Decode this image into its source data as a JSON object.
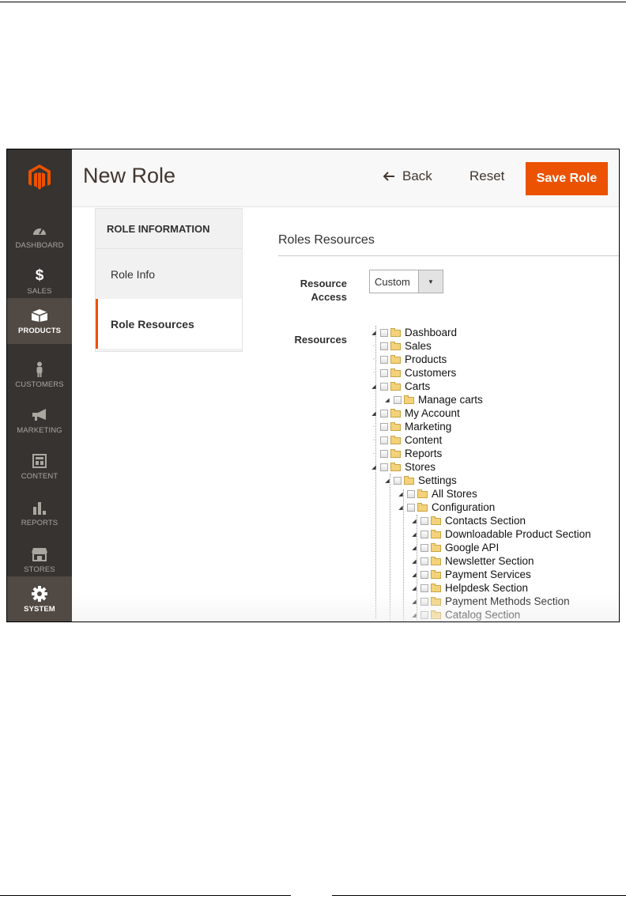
{
  "header": {
    "title": "New Role",
    "back_label": "Back",
    "reset_label": "Reset",
    "save_label": "Save Role"
  },
  "sidebar": {
    "items": [
      {
        "label": "DASHBOARD",
        "icon": "dashboard-icon"
      },
      {
        "label": "SALES",
        "icon": "dollar-icon"
      },
      {
        "label": "PRODUCTS",
        "icon": "box-icon"
      },
      {
        "label": "CUSTOMERS",
        "icon": "person-icon"
      },
      {
        "label": "MARKETING",
        "icon": "megaphone-icon"
      },
      {
        "label": "CONTENT",
        "icon": "layout-icon"
      },
      {
        "label": "REPORTS",
        "icon": "bar-chart-icon"
      },
      {
        "label": "STORES",
        "icon": "storefront-icon"
      },
      {
        "label": "SYSTEM",
        "icon": "gear-icon"
      }
    ]
  },
  "tabs": {
    "title": "ROLE INFORMATION",
    "items": [
      {
        "label": "Role Info"
      },
      {
        "label": "Role Resources"
      }
    ]
  },
  "main": {
    "section_title": "Roles Resources",
    "resource_access_label": "Resource Access",
    "resource_access_value": "Custom",
    "resources_label": "Resources"
  },
  "tree": [
    {
      "label": "Dashboard"
    },
    {
      "label": "Sales"
    },
    {
      "label": "Products"
    },
    {
      "label": "Customers"
    },
    {
      "label": "Carts"
    },
    {
      "label": "Manage carts"
    },
    {
      "label": "My Account"
    },
    {
      "label": "Marketing"
    },
    {
      "label": "Content"
    },
    {
      "label": "Reports"
    },
    {
      "label": "Stores"
    },
    {
      "label": "Settings"
    },
    {
      "label": "All Stores"
    },
    {
      "label": "Configuration"
    },
    {
      "label": "Contacts Section"
    },
    {
      "label": "Downloadable Product Section"
    },
    {
      "label": "Google API"
    },
    {
      "label": "Newsletter Section"
    },
    {
      "label": "Payment Services"
    },
    {
      "label": "Helpdesk Section"
    },
    {
      "label": "Payment Methods Section"
    },
    {
      "label": "Catalog Section"
    }
  ],
  "colors": {
    "accent": "#eb5202",
    "sidebar_bg": "#373330",
    "sidebar_active": "#514943"
  }
}
